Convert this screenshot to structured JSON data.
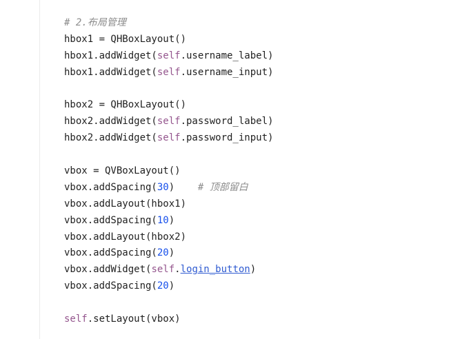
{
  "editor": {
    "lines": [
      [
        {
          "t": "# 2.布局管理",
          "k": "comment"
        }
      ],
      [
        {
          "t": "hbox1 = QHBoxLayout()",
          "k": "plain"
        }
      ],
      [
        {
          "t": "hbox1.addWidget(",
          "k": "plain"
        },
        {
          "t": "self",
          "k": "self"
        },
        {
          "t": ".username_label)",
          "k": "plain"
        }
      ],
      [
        {
          "t": "hbox1.addWidget(",
          "k": "plain"
        },
        {
          "t": "self",
          "k": "self"
        },
        {
          "t": ".username_input)",
          "k": "plain"
        }
      ],
      [],
      [
        {
          "t": "hbox2 = QHBoxLayout()",
          "k": "plain"
        }
      ],
      [
        {
          "t": "hbox2.addWidget(",
          "k": "plain"
        },
        {
          "t": "self",
          "k": "self"
        },
        {
          "t": ".password_label)",
          "k": "plain"
        }
      ],
      [
        {
          "t": "hbox2.addWidget(",
          "k": "plain"
        },
        {
          "t": "self",
          "k": "self"
        },
        {
          "t": ".password_input)",
          "k": "plain"
        }
      ],
      [],
      [
        {
          "t": "vbox = QVBoxLayout()",
          "k": "plain"
        }
      ],
      [
        {
          "t": "vbox.addSpacing(",
          "k": "plain"
        },
        {
          "t": "30",
          "k": "num"
        },
        {
          "t": ")    ",
          "k": "plain"
        },
        {
          "t": "# 顶部留白",
          "k": "comment"
        }
      ],
      [
        {
          "t": "vbox.addLayout(hbox1)",
          "k": "plain"
        }
      ],
      [
        {
          "t": "vbox.addSpacing(",
          "k": "plain"
        },
        {
          "t": "10",
          "k": "num"
        },
        {
          "t": ")",
          "k": "plain"
        }
      ],
      [
        {
          "t": "vbox.addLayout(hbox2)",
          "k": "plain"
        }
      ],
      [
        {
          "t": "vbox.addSpacing(",
          "k": "plain"
        },
        {
          "t": "20",
          "k": "num"
        },
        {
          "t": ")",
          "k": "plain"
        }
      ],
      [
        {
          "t": "vbox.addWidget(",
          "k": "plain"
        },
        {
          "t": "self",
          "k": "self"
        },
        {
          "t": ".",
          "k": "plain"
        },
        {
          "t": "login_button",
          "k": "attr-link"
        },
        {
          "t": ")",
          "k": "plain"
        }
      ],
      [
        {
          "t": "vbox.addSpacing(",
          "k": "plain"
        },
        {
          "t": "20",
          "k": "num"
        },
        {
          "t": ")",
          "k": "plain"
        }
      ],
      [],
      [
        {
          "t": "self",
          "k": "self"
        },
        {
          "t": ".setLayout(vbox)",
          "k": "plain"
        }
      ]
    ]
  }
}
